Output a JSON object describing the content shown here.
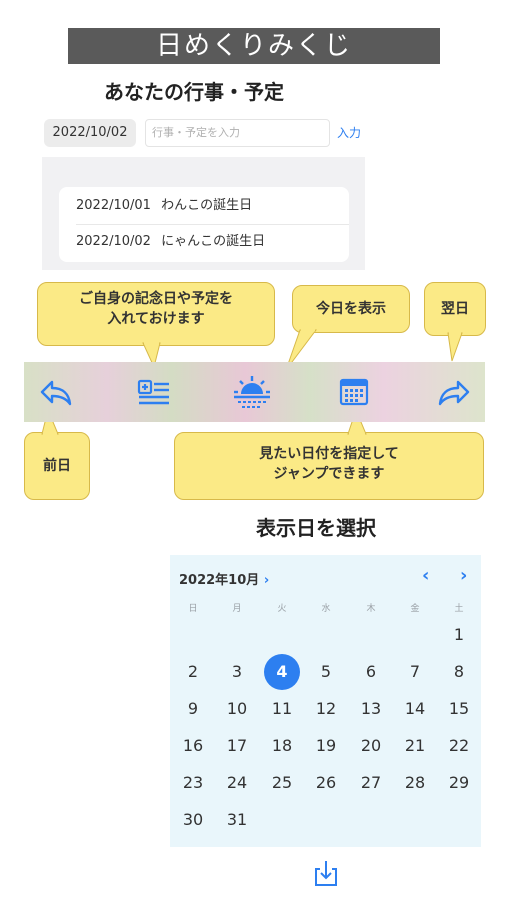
{
  "banner": "日めくりみくじ",
  "sections": {
    "events_title": "あなたの行事・予定",
    "date_select_title": "表示日を選択"
  },
  "entry": {
    "date": "2022/10/02",
    "placeholder": "行事・予定を入力",
    "submit_label": "入力"
  },
  "events": [
    {
      "date": "2022/10/01",
      "title": "わんこの誕生日"
    },
    {
      "date": "2022/10/02",
      "title": "にゃんこの誕生日"
    }
  ],
  "tooltips": {
    "add_events": [
      "ご自身の記念日や予定を",
      "入れておけます"
    ],
    "today": "今日を表示",
    "next_day": "翌日",
    "prev_day": "前日",
    "calendar_jump": [
      "見たい日付を指定して",
      "ジャンプできます"
    ]
  },
  "toolbar": {
    "icons": [
      "back-arrow-icon",
      "add-list-icon",
      "sunrise-icon",
      "calendar-icon",
      "forward-arrow-icon"
    ],
    "accent_color": "#2d7ff0"
  },
  "calendar": {
    "month_label": "2022年10月",
    "month_chevron": "›",
    "prev_label": "‹",
    "next_label": "›",
    "weekdays": [
      "日",
      "月",
      "火",
      "水",
      "木",
      "金",
      "土"
    ],
    "first_weekday_index": 6,
    "days_in_month": 31,
    "selected_day": 4,
    "selected_color": "#2d7ff0"
  },
  "share_icon": "share-download-icon"
}
